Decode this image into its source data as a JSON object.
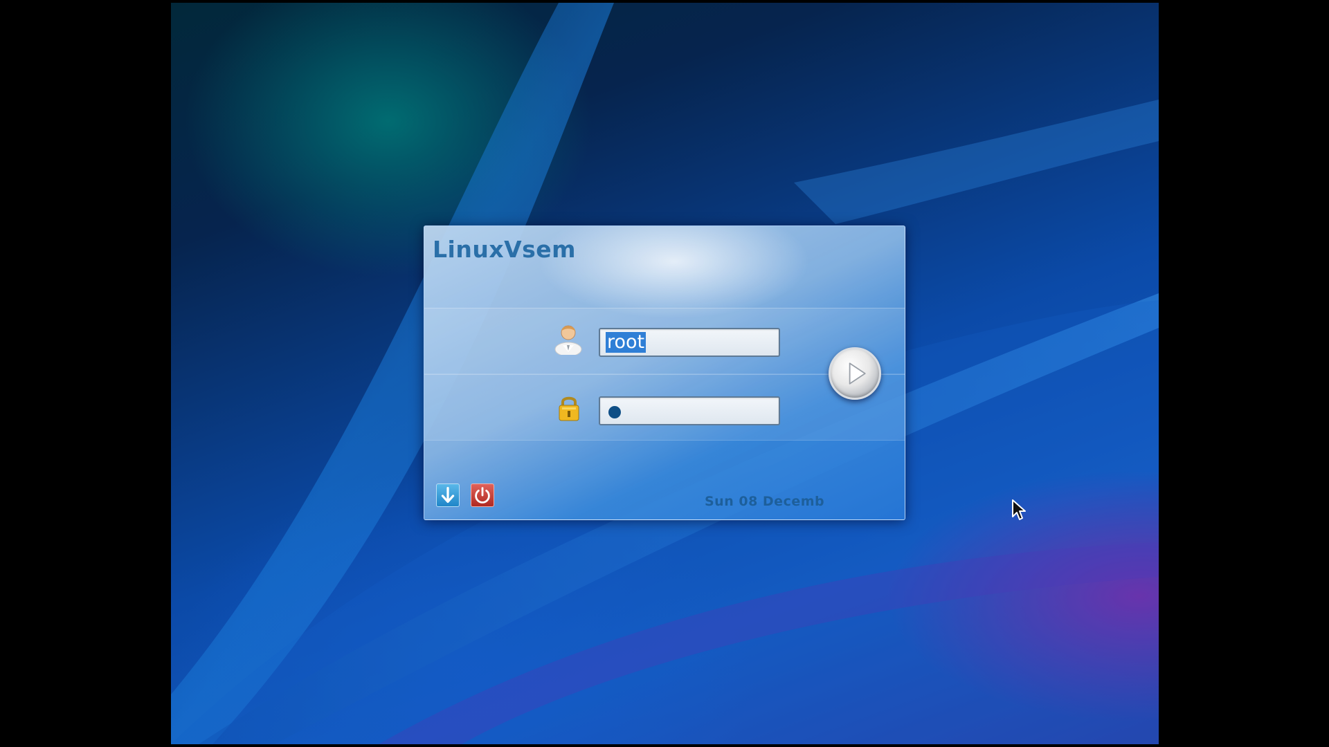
{
  "login": {
    "title": "LinuxVsem",
    "username_value": "root",
    "password_masked": "●",
    "date_text": "Sun 08 Decemb"
  },
  "icons": {
    "user": "user-icon",
    "password": "lock-icon",
    "login": "play-arrow-icon",
    "session": "down-arrow-icon",
    "shutdown": "power-icon",
    "cursor": "mouse-pointer-icon"
  },
  "colors": {
    "title": "#2a6fa8",
    "selection": "#2f7fd6",
    "date_text": "#1d5f9b",
    "shutdown_button": "#b02a22",
    "session_button": "#1f86c8"
  }
}
